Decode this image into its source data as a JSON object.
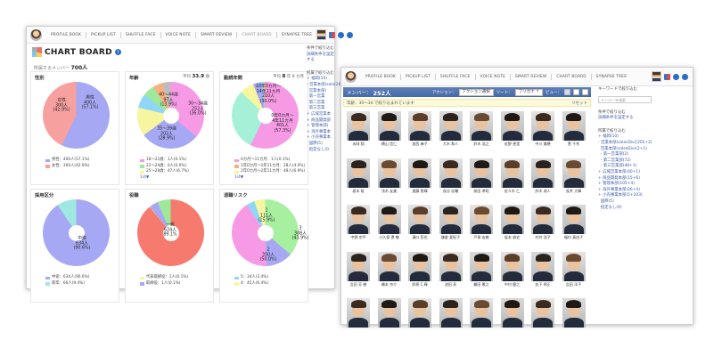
{
  "nav": {
    "items": [
      "PROFILE BOOK",
      "PICKUP LIST",
      "SHUFFLE FACE",
      "VOICE NOTE",
      "SMART REVIEW",
      "CHART BOARD",
      "SYNAPSE TREE"
    ],
    "back_active_index": 5,
    "front_active_index": -1
  },
  "chart_board": {
    "title": "CHART BOARD",
    "badge": "7",
    "members_label": "所属するメンバー",
    "members_count": "700人",
    "charts": [
      {
        "title": "性別",
        "stat_label": "",
        "stat_value": "",
        "stat_unit": "",
        "type": "pie",
        "colors": [
          "#a6a8f4",
          "#f7a0a0"
        ],
        "series": [
          {
            "values": [
              400,
              300
            ]
          }
        ],
        "labels": [
          "男性\n400人\n(57.1%)",
          "女性\n300人\n(42.9%)"
        ],
        "legend": [
          "男性：400人(57.1%)",
          "女性：300人(42.9%)"
        ],
        "legend_colors": [
          "#a6a8f4",
          "#f7a0a0"
        ]
      },
      {
        "title": "年齢",
        "stat_label": "平均",
        "stat_value": "33.9",
        "stat_unit": "歳",
        "type": "donut",
        "colors": [
          "#f79ae6",
          "#a6a8f4",
          "#f6f6a0",
          "#90d6f6",
          "#9ee89a",
          "#f7b083",
          "#bdbdbd"
        ],
        "series": [
          {
            "values": [
              252,
              202,
              97,
              48,
              40,
              34,
              27
            ]
          }
        ],
        "labels": [
          "30〜34歳\n252人\n(36.0%)",
          "35〜39歳\n202人\n(28.9%)",
          "40〜44歳\n97人\n(13.9%)"
        ],
        "legend": [
          "18〜21歳：1人(0.1%)",
          "22〜24歳：0人(0.0%)",
          "25〜29歳：47人(6.7%)"
        ],
        "legend_colors": [
          "#f79ae6",
          "#9ee89a",
          "#f6f6a0"
        ],
        "more": "1/4▼"
      },
      {
        "title": "勤続年数",
        "stat_label": "平均",
        "stat_value": "8",
        "stat_unit": "年 8 カ月",
        "type": "donut",
        "colors": [
          "#f79ae6",
          "#a6f0d8",
          "#f6f6a0",
          "#a6a8f4",
          "#90d6f6",
          "#f7b083"
        ],
        "series": [
          {
            "values": [
              401,
              210,
              48,
              28,
              8,
              5
            ]
          }
        ],
        "labels": [
          "10年0カ月〜\n14年11カ月\n210人\n(30.0%)",
          "0年0カ月〜\n4年11カ月\n401人\n(57.3%)"
        ],
        "legend": [
          "0カ月〜11カ月：1人(0.1%)",
          "1年0カ月〜1年11カ月：28人(4.0%)",
          "2年0カ月〜2年11カ月：48人(6.9%)"
        ],
        "legend_colors": [
          "#f79ae6",
          "#f7b083",
          "#f6f6a0"
        ],
        "more": "1/4▼"
      },
      {
        "title": "採用区分",
        "stat_label": "",
        "stat_value": "",
        "stat_unit": "",
        "type": "donut",
        "colors": [
          "#a6a8f4",
          "#9ee8e0"
        ],
        "series": [
          {
            "values": [
              634,
              66
            ]
          }
        ],
        "labels": [
          "中途\n634人\n(90.6%)"
        ],
        "legend": [
          "中途：634人(90.6%)",
          "新卒：66人(9.4%)"
        ],
        "legend_colors": [
          "#a6a8f4",
          "#9ee8e0"
        ]
      },
      {
        "title": "役職",
        "stat_label": "",
        "stat_value": "",
        "stat_unit": "",
        "type": "donut",
        "colors": [
          "#f77a6e",
          "#f6f6a0",
          "#a6a8f4",
          "#9ee89a"
        ],
        "series": [
          {
            "values": [
              624,
              1,
              30,
              45
            ]
          }
        ],
        "labels": [
          "一般\n624人\n89.1%"
        ],
        "legend": [
          "代表取締役：1人(0.1%)",
          "取締役：1人(0.1%)"
        ],
        "legend_colors": [
          "#f6f6a0",
          "#a6a8f4"
        ]
      },
      {
        "title": "退職リスク",
        "stat_label": "",
        "stat_value": "",
        "stat_unit": "",
        "type": "donut",
        "colors": [
          "#a6f0a0",
          "#a6a8f4",
          "#f79ae6",
          "#90d6f6",
          "#f6f6a0"
        ],
        "series": [
          {
            "values": [
              308,
              111,
              350,
              34,
              45
            ]
          }
        ],
        "labels": [
          "1\n111人\n(15.9%)",
          "3\n308人\n(43.9%)",
          "2\n350人\n(50.0%)"
        ],
        "legend": [
          "5：34人(3.4%)",
          "4：45人(6.4%)"
        ],
        "legend_colors": [
          "#90d6f6",
          "#f6f6a0"
        ]
      }
    ],
    "sidebar": {
      "cond_label": "条件で絞り込む",
      "cond_link": "詳細条件を設定する",
      "group_label": "所属で絞り込む",
      "groups": [
        "+ 福岡(10)",
        "- 営業本部(sale(20)",
        "  営業本部(",
        "  第一営業",
        "  第二営業",
        "  第三営業",
        "+ 広域営業本",
        "+ 商品開発部",
        "+ 管理本部(",
        "+ 海外事業本",
        "+ 小売事業本",
        "  国際(5)",
        "  指定なし(0"
      ]
    }
  },
  "member_window": {
    "member_label": "メンバー：",
    "member_count": "252人",
    "action_label": "アクション：",
    "action_select": "アクション選択",
    "sort_label": "ソート：",
    "sort_select": "フリガナ ↑",
    "view_label": "ビュー：",
    "filter_text": "年齢：30〜34 で絞り込まれています",
    "reset_label": "リセット",
    "sidebar": {
      "keyword_label": "キーワードで絞り込む",
      "search_placeholder": "メンバーを検索",
      "cond_label": "条件で絞り込む",
      "cond_link": "詳細条件を設定する",
      "group_label": "所属で絞り込む",
      "groups": [
        "+ 福岡(10)",
        "- 営業本部(salesDiv)(205+2)",
        "  営業本部(salesDiv)(2+1)",
        "  - 第一営業部(2)",
        "  - 第二営業部(72)",
        "  - 第三営業部(48+1)",
        "+ 広域営業本部(40+1)",
        "+ 商品開発本部(15+6)",
        "+ 管理本部(105+4)",
        "+ 海外事業本部(26+4)",
        "+ 小売事業本部(5+203)",
        "  国際(5)",
        "  指定なし(0)"
      ]
    },
    "people": [
      [
        "永岡 翔",
        "横山 信仁",
        "加西 麻子",
        "大木 和人",
        "鈴木 浩之",
        "佐野 恵里",
        "中川 美穂",
        "菅 千秀"
      ],
      [
        "坂本 裕",
        "浅木 友美",
        "遠藤 恵輝",
        "長谷 佳輔",
        "前田 孝昭",
        "佐々木 仁",
        "鈴木 成人",
        "長井 大輝"
      ],
      [
        "中野 宗平",
        "小久保 遼 敬",
        "溝口 哲也",
        "鎌倉 愛紀子",
        "戸塚 宏樹",
        "坂本 俊史",
        "村井 浩子",
        "福内 真由子"
      ],
      [
        "吉田 芳 樹",
        "橋本 京介",
        "鈴原 C 輝",
        "池田 亮",
        "鶴田 雅之",
        "中村 健之",
        "矢下 明正",
        "吉田 洋子"
      ],
      [
        "",
        "",
        "",
        "",
        "",
        "",
        "",
        ""
      ]
    ]
  }
}
